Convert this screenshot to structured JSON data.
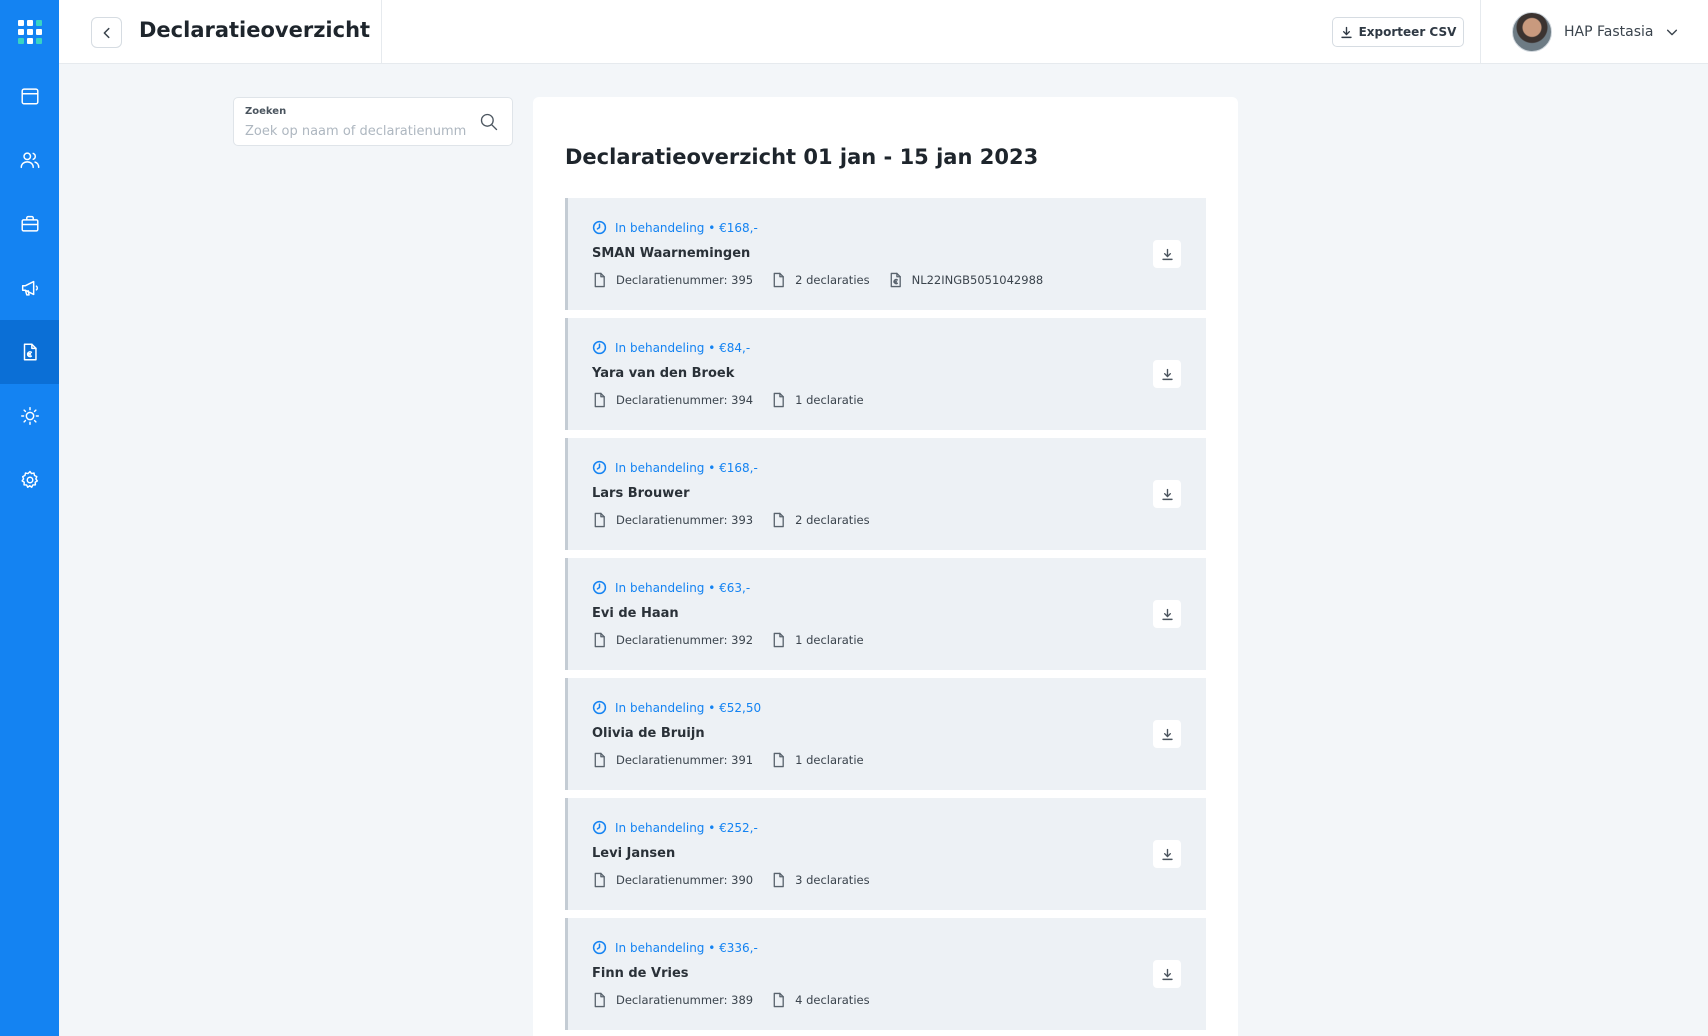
{
  "header": {
    "title": "Declaratieoverzicht",
    "export_label": "Exporteer CSV",
    "user_name": "HAP Fastasia"
  },
  "sidebar": {
    "items": [
      {
        "icon": "calendar-icon"
      },
      {
        "icon": "users-icon"
      },
      {
        "icon": "briefcase-icon"
      },
      {
        "icon": "megaphone-icon"
      },
      {
        "icon": "invoice-icon",
        "active": true
      },
      {
        "icon": "sun-icon"
      },
      {
        "icon": "gear-icon"
      }
    ]
  },
  "search": {
    "label": "Zoeken",
    "placeholder": "Zoek op naam of declaratienummer"
  },
  "panel": {
    "title": "Declaratieoverzicht 01 jan - 15 jan 2023"
  },
  "declarations": [
    {
      "status": "In behandeling • €168,-",
      "name": "SMAN Waarnemingen",
      "number": "Declaratienummer: 395",
      "count": "2 declaraties",
      "iban": "NL22INGB5051042988"
    },
    {
      "status": "In behandeling • €84,-",
      "name": "Yara van den Broek",
      "number": "Declaratienummer: 394",
      "count": "1 declaratie"
    },
    {
      "status": "In behandeling • €168,-",
      "name": "Lars Brouwer",
      "number": "Declaratienummer: 393",
      "count": "2 declaraties"
    },
    {
      "status": "In behandeling • €63,-",
      "name": "Evi de Haan",
      "number": "Declaratienummer: 392",
      "count": "1 declaratie"
    },
    {
      "status": "In behandeling • €52,50",
      "name": "Olivia de Bruijn",
      "number": "Declaratienummer: 391",
      "count": "1 declaratie"
    },
    {
      "status": "In behandeling • €252,-",
      "name": "Levi Jansen",
      "number": "Declaratienummer: 390",
      "count": "3 declaraties"
    },
    {
      "status": "In behandeling • €336,-",
      "name": "Finn de Vries",
      "number": "Declaratienummer: 389",
      "count": "4 declaraties"
    }
  ],
  "colors": {
    "primary": "#1483f2",
    "sidebar_active": "#0b6fd6",
    "card_bg": "#edf1f5",
    "page_bg": "#f3f6f9"
  }
}
